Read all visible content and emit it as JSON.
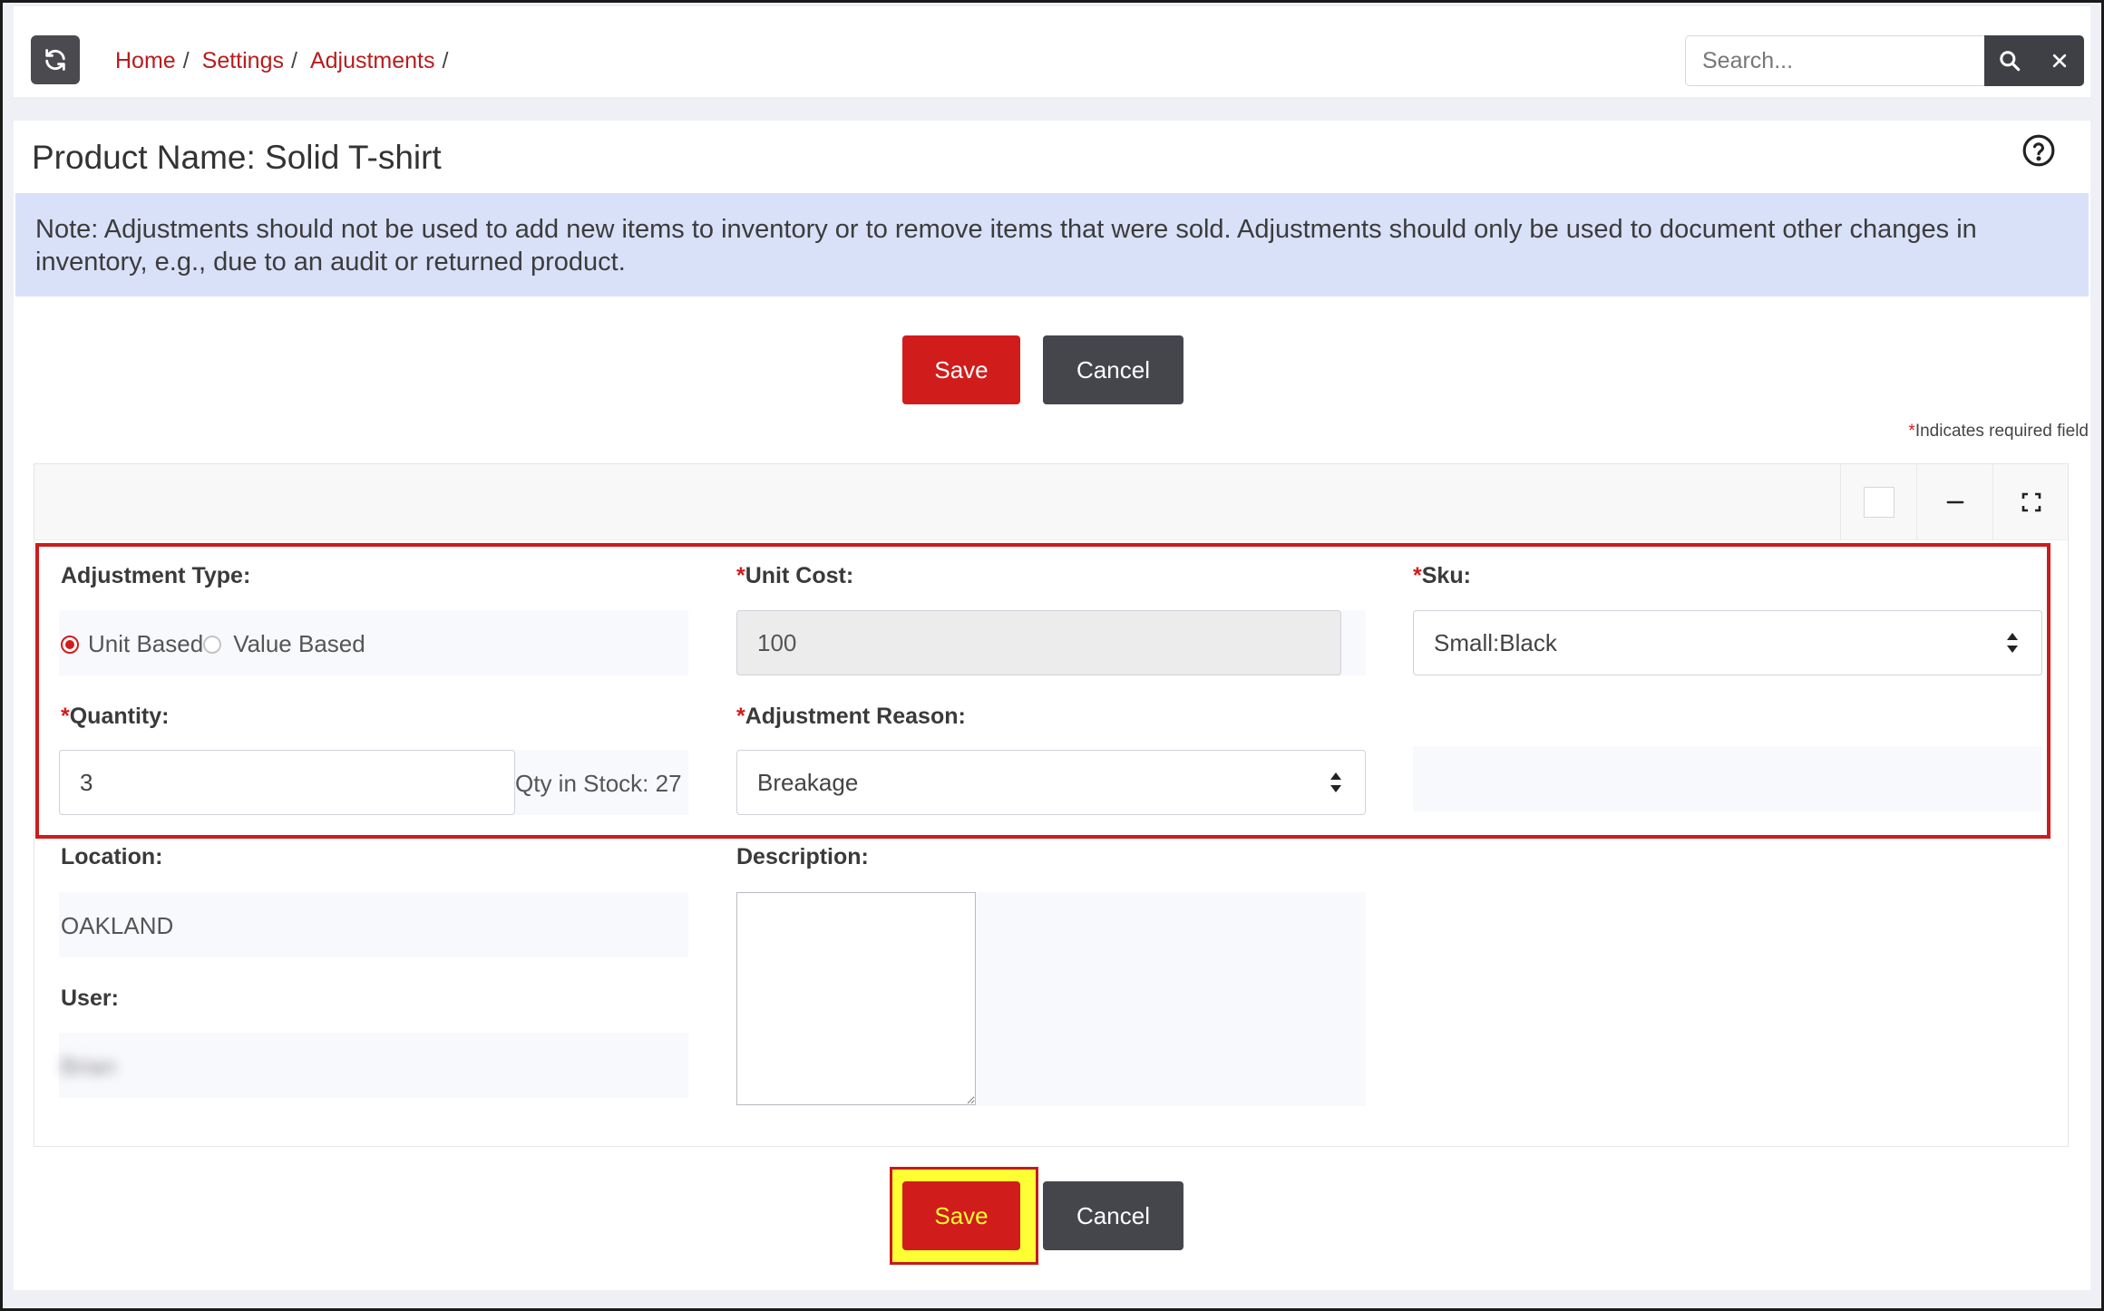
{
  "breadcrumb": {
    "items": [
      {
        "label": "Home"
      },
      {
        "label": "Settings"
      },
      {
        "label": "Adjustments"
      }
    ],
    "separator": "/"
  },
  "search": {
    "placeholder": "Search...",
    "value": ""
  },
  "page": {
    "title": "Product Name: Solid T-shirt",
    "note": "Note: Adjustments should not be used to add new items to inventory or to remove items that were sold. Adjustments should only be used to document other changes in inventory, e.g., due to an audit or returned product.",
    "required_marker": "*",
    "required_text": "Indicates required field"
  },
  "buttons": {
    "save_label": "Save",
    "cancel_label": "Cancel"
  },
  "form": {
    "adjustment_type": {
      "label": "Adjustment Type:",
      "options": [
        "Unit Based",
        "Value Based"
      ],
      "selected": "Unit Based"
    },
    "unit_cost": {
      "label": "Unit Cost:",
      "required": "*",
      "value": "100"
    },
    "sku": {
      "label": "Sku:",
      "required": "*",
      "value": "Small:Black"
    },
    "quantity": {
      "label": "Quantity:",
      "required": "*",
      "value": "3",
      "stock_text": "Qty in Stock: 27"
    },
    "adjustment_reason": {
      "label": "Adjustment Reason:",
      "required": "*",
      "value": "Breakage"
    },
    "location": {
      "label": "Location:",
      "value": "OAKLAND"
    },
    "user": {
      "label": "User:",
      "value": "Brian"
    },
    "description": {
      "label": "Description:",
      "value": ""
    }
  },
  "colors": {
    "accent": "#d11c1c",
    "dark_button": "#45464c",
    "note_bg": "#d9e1f9",
    "highlight_yellow": "#ffff33"
  },
  "icons": {
    "refresh": "refresh-icon",
    "search": "search-icon",
    "clear": "close-icon",
    "help": "help-circle-icon",
    "minimize": "minus-icon",
    "expand": "expand-icon",
    "select": "select-arrows-icon"
  }
}
